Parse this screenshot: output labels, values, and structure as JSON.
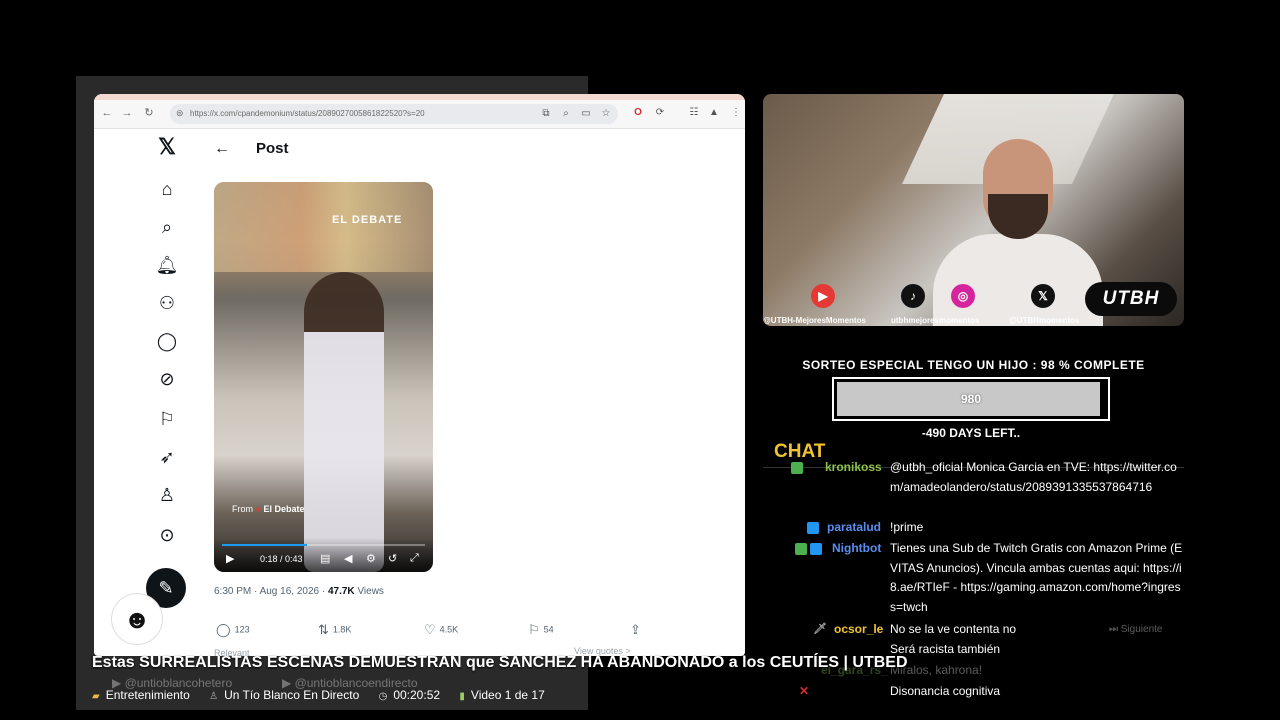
{
  "browser": {
    "url": "https://x.com/cpandemonium/status/2089027005861822520?s=20",
    "icons": [
      "back-icon",
      "forward-icon",
      "reload-icon",
      "site-info-icon",
      "translate-icon",
      "zoom-icon",
      "cast-icon",
      "star-icon",
      "opera-icon",
      "extensions-icon",
      "tab-search-icon",
      "profile-icon",
      "menu-icon"
    ]
  },
  "x_app": {
    "post_title": "Post",
    "video_watermark": "EL DEBATE",
    "video_from": "From",
    "video_from_source": "El Debate",
    "video_time": "0:18 / 0:43",
    "video_progress": 0.42,
    "post_time": "6:30 PM · Aug 16, 2026 ·",
    "views_count": "47.7K",
    "views_label": "Views",
    "replies": "123",
    "reposts": "1.8K",
    "likes": "4.5K",
    "bookmarks": "54",
    "relevant_label": "Relevant",
    "view_quotes": "View quotes >"
  },
  "webcam": {
    "logo": "UTBH",
    "handles": [
      "@UTBH-MejoresMomentos",
      "utbhmejoresmomentos",
      "@UTBHmomentos"
    ]
  },
  "giveaway": {
    "title": "SORTEO ESPECIAL TENGO UN HIJO :  98 % COMPLETE",
    "progress_value": "980",
    "progress_fraction": 0.98,
    "days_left": "-490 DAYS LEFT.."
  },
  "chat": {
    "title": "CHAT",
    "messages": [
      {
        "user": "kronikoss",
        "text": "@utbh_oficial Monica Garcia en TVE: https://twitter.com/amadeolandero/status/2089391335537864716",
        "color": "#8bc34a"
      },
      {
        "user": "paratalud",
        "text": "!prime",
        "color": "#5b8def"
      },
      {
        "user": "Nightbot",
        "text": "Tienes una Sub de Twitch Gratis con Amazon Prime (EVITAS Anuncios). Vincula ambas cuentas aqui: https://i8.ae/RTIeF - https://gaming.amazon.com/home?ingress=twch",
        "color": "#5b8def"
      },
      {
        "user": "ocsor_le",
        "text": "No se la ve contenta no",
        "color": "#f1c232"
      },
      {
        "user": "",
        "text": "Será racista también",
        "color": "#5b8def"
      },
      {
        "user": "el_gara_rs_",
        "text": "Miralos, kahrona!",
        "color": "#8bc34a"
      },
      {
        "user": "",
        "text": "Disonancia cognitiva",
        "color": "#5b8def"
      }
    ],
    "next_label": "Siguiente"
  },
  "footer": {
    "video_title": "Estas SURREALISTAS ESCENAS DEMUESTRAN que SANCHEZ HA ABANDONADO a los CEUTÍES | UTBED",
    "category": "Entretenimiento",
    "channel": "Un Tío Blanco En Directo",
    "duration": "00:20:52",
    "video_index": "Video 1 de 17",
    "ghost_channel_1": "@untioblancohetero",
    "ghost_channel_2": "@untioblancoendirecto"
  }
}
